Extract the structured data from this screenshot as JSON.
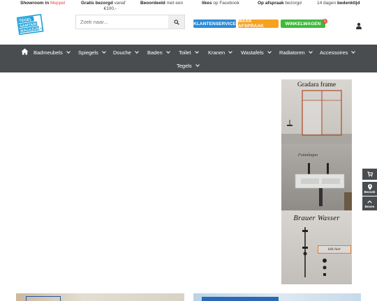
{
  "topbar": {
    "showroom_prefix": "Showroom in",
    "showroom_city": "Meppel",
    "shipping_bold": "Gratis bezorgd",
    "shipping_rest": "vanaf",
    "shipping_amount": "€100,-",
    "rated_bold": "Beoordeeld",
    "rated_rest": "met een",
    "likes_bold": "likes",
    "likes_rest": "op Facebook",
    "ondemand_bold": "Op afspraak",
    "ondemand_rest": "bezorgd",
    "returns_prefix": "14 dagen",
    "returns_bold": "bedenktijd"
  },
  "logo": {
    "line1": "TEGEL EN",
    "line2": "SANITAIR",
    "line3": "MAGAZIJN",
    "suffix": ".NL"
  },
  "search": {
    "placeholder": "Zoek naar..."
  },
  "buttons": {
    "service": "KLANTENSERVICE",
    "appointment": "MAAK AFSPRAAK",
    "cart": "WINKELWAGEN",
    "cart_count": "0"
  },
  "nav": {
    "items": [
      {
        "label": "Badmeubels"
      },
      {
        "label": "Spiegels"
      },
      {
        "label": "Douche"
      },
      {
        "label": "Baden"
      },
      {
        "label": "Toilet"
      },
      {
        "label": "Kranen"
      },
      {
        "label": "Wastafels"
      },
      {
        "label": "Radiatoren"
      },
      {
        "label": "Accessoires"
      },
      {
        "label": "Tegels"
      }
    ]
  },
  "banner": {
    "title1": "Gradara frame",
    "title2": "Fontalaqua",
    "title3": "Brauer Wasser",
    "cta": "klik hier"
  },
  "side": {
    "route": "Bezoek",
    "top": "Boven"
  },
  "icons": {
    "home": "home-icon",
    "search": "search-icon",
    "user": "user-icon",
    "cart": "cart-icon",
    "location": "location-pin-icon",
    "top": "chevron-up-icon"
  },
  "colors": {
    "nav_bg": "#4a4d4f",
    "service_btn": "#2a8bd8",
    "appointment_btn": "#f7a120",
    "cart_btn": "#3fb93b",
    "badge": "#e64a3b",
    "logo_blue": "#1aa0d8"
  }
}
